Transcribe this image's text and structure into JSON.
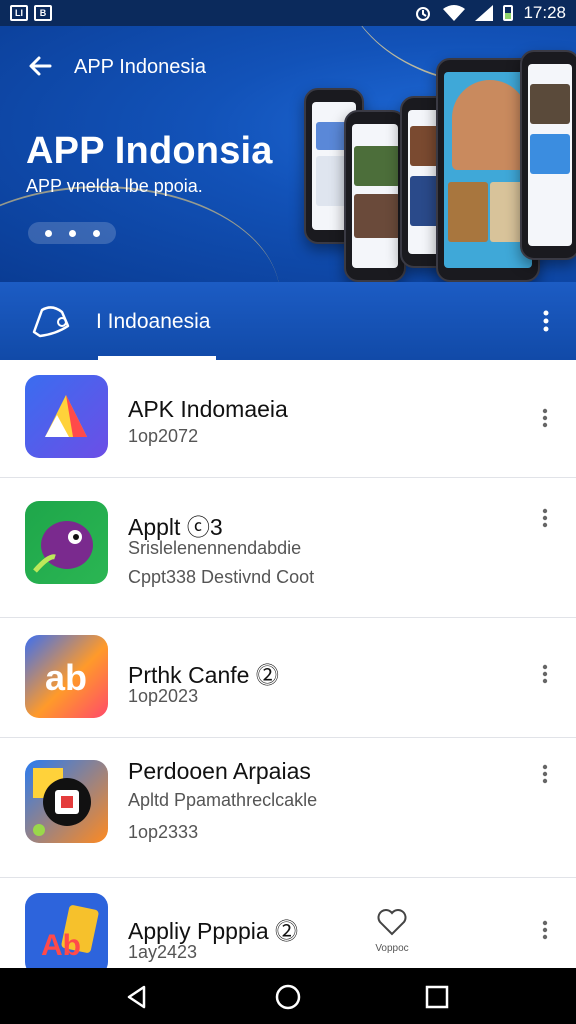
{
  "status_bar": {
    "left_badges": [
      "LI",
      "B"
    ],
    "time": "17:28",
    "icons": [
      "alarm-icon",
      "wifi-icon",
      "signal-icon",
      "battery-icon"
    ]
  },
  "hero": {
    "nav_title": "APP Indonesia",
    "title": "APP Indonsia",
    "subtitle": "APP vnelda lbe ppoia."
  },
  "tabs": {
    "label": "I Indoanesia"
  },
  "apps": [
    {
      "name": "APK Indomaeia",
      "lines": [
        "1op2072"
      ],
      "icon": "triangle-logo-icon",
      "colors": [
        "#3a6df0",
        "#6c4ee6"
      ]
    },
    {
      "name": "Applt ⓒ3",
      "lines": [
        "Srislelenennendabdie",
        "Cppt338 Destivnd Coot"
      ],
      "icon": "green-bird-logo-icon",
      "colors": [
        "#1ea64a",
        "#2bb653"
      ]
    },
    {
      "name": "Prthk Canfe ⓶",
      "lines": [
        "1op2023"
      ],
      "icon": "ab-logo-icon",
      "colors": [
        "#3c6ff0",
        "#ff4a6a"
      ]
    },
    {
      "name": "Perdooen Arpaias",
      "lines": [
        "Apltd Ppamathreclcakle",
        "1op2333"
      ],
      "icon": "photo-logo-icon",
      "colors": [
        "#ff8a20",
        "#2a7bf0"
      ]
    },
    {
      "name": "Appliy Ppppia ⓶",
      "lines": [
        "1ay2423"
      ],
      "icon": "ad-logo-icon",
      "colors": [
        "#2d64dc",
        "#f6c12c"
      ]
    }
  ],
  "floating": {
    "label": "Voppoc"
  }
}
